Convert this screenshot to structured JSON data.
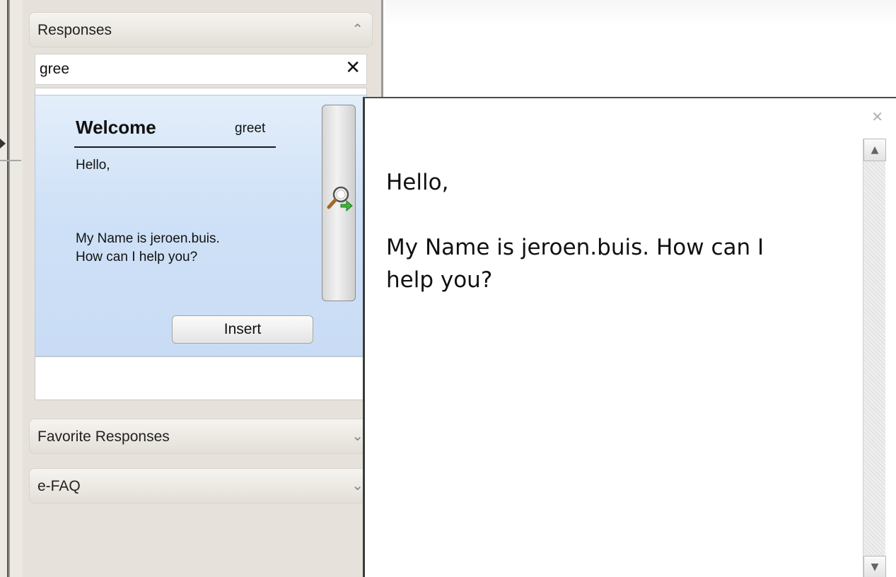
{
  "responses_panel": {
    "header": {
      "title": "Responses",
      "chevron_icon": "chevron-up-icon"
    },
    "search": {
      "value": "gree",
      "clear_icon": "close-icon",
      "clear_symbol": "✕"
    },
    "result": {
      "title": "Welcome",
      "shortcut": "greet",
      "body": "Hello,\n\n\n\nMy Name is jeroen.buis.\nHow can I help you?",
      "preview_icon": "magnify-arrow-icon",
      "insert_label": "Insert"
    },
    "sections": [
      {
        "title": "Favorite Responses",
        "chevron_icon": "chevron-down-icon"
      },
      {
        "title": "e-FAQ",
        "chevron_icon": "chevron-down-icon"
      }
    ]
  },
  "preview_popup": {
    "close_icon": "close-icon",
    "close_symbol": "✕",
    "text": "Hello,\n\nMy Name is jeroen.buis. How can I\nhelp you?",
    "scroll_up_icon": "scroll-up-arrow-icon",
    "scroll_down_icon": "scroll-down-arrow-icon"
  },
  "colors": {
    "card_gradient_top": "#e3eefa",
    "card_gradient_bottom": "#c9dcf5",
    "panel_background": "#e6e2db"
  }
}
